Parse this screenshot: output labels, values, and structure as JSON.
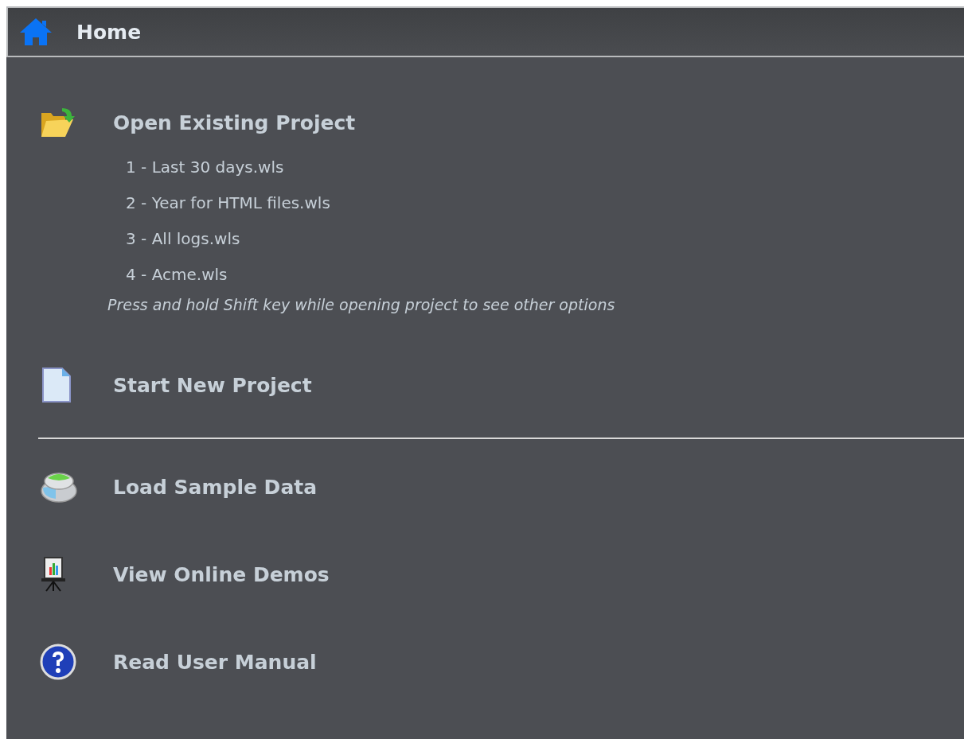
{
  "header": {
    "title": "Home"
  },
  "sections": [
    {
      "actions": [
        {
          "kind": "open",
          "label": "Open Existing Project",
          "recent_files": [
            "1 - Last 30 days.wls",
            "2 - Year for HTML files.wls",
            "3 - All logs.wls",
            "4 - Acme.wls"
          ],
          "hint": "Press and hold Shift key while opening project to see other options"
        },
        {
          "kind": "new",
          "label": "Start New Project"
        }
      ]
    },
    {
      "actions": [
        {
          "kind": "sample",
          "label": "Load Sample Data"
        },
        {
          "kind": "demos",
          "label": "View Online Demos"
        },
        {
          "kind": "manual",
          "label": "Read User Manual"
        }
      ]
    }
  ]
}
